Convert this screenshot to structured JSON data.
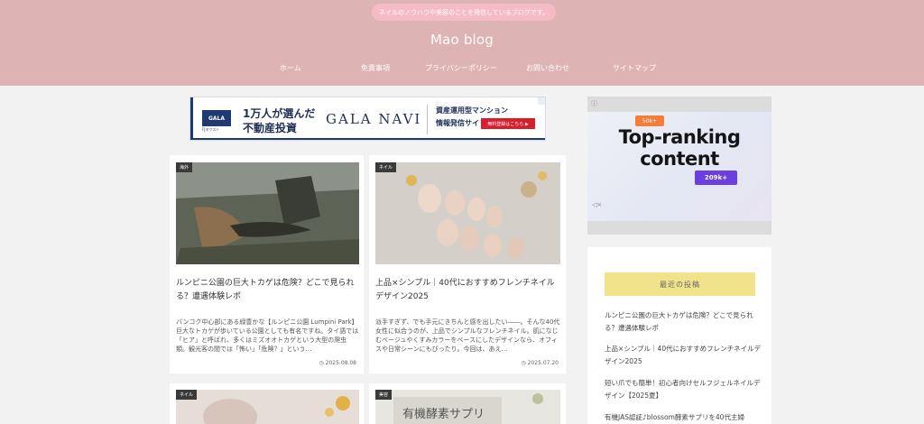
{
  "header": {
    "tagline": "ネイルのノウハウや美容のことを発信しているブログです。",
    "site_title": "Mao blog",
    "nav": [
      "ホーム",
      "免責事項",
      "プライバシーポリシー",
      "お問い合わせ",
      "サイトマップ"
    ]
  },
  "banner": {
    "logo": "GALA",
    "logo_sub": "FJネクスト",
    "headline_1": "1万人が選んだ",
    "headline_2": "不動産投資",
    "brand": "GALA NAVI",
    "right_1": "資産運用型マンション",
    "right_2": "情報発信サイト",
    "cta": "無料登録はこちら ▶"
  },
  "posts": [
    {
      "category": "海外",
      "title": "ルンピニ公園の巨大トカゲは危険？どこで見られる？遭遇体験レポ",
      "excerpt": "バンコク中心部にある緑豊かな【ルンピニ公園 Lumpini Park】巨大なトカゲが歩いている公園としても有名ですね。タイ語では「ヒア」と呼ばれ、多くはミズオオトカゲという大型の爬虫類。観光客の間では「怖い」「危険？」という…",
      "date": "2025.08.08"
    },
    {
      "category": "ネイル",
      "title": "上品×シンプル｜40代におすすめフレンチネイルデザイン2025",
      "excerpt": "派手すぎず、でも手元にきちんと感を出したい――。そんな40代女性に似合うのが、上品でシンプルなフレンチネイル。肌になじむベージュやくすみカラーをベースにしたデザインなら、オフィスや日常シーンにもぴったり。今回は、あえ…",
      "date": "2025.07.20"
    },
    {
      "category": "ネイル"
    },
    {
      "category": "美容",
      "thumb_text": "有機酵素サプリ"
    }
  ],
  "ad": {
    "badge_top": "50k+",
    "headline": "Top-ranking content",
    "badge_bottom": "209k+"
  },
  "sidebar": {
    "widget_title": "最近の投稿",
    "recent_posts": [
      "ルンピニ公園の巨大トカゲは危険？どこで見られる？遭遇体験レポ",
      "上品×シンプル｜40代におすすめフレンチネイルデザイン2025",
      "短い爪でも簡単！初心者向けセルフジェルネイルデザイン【2025夏】",
      "有機JAS認証♪blossom酵素サプリを40代主婦"
    ]
  }
}
